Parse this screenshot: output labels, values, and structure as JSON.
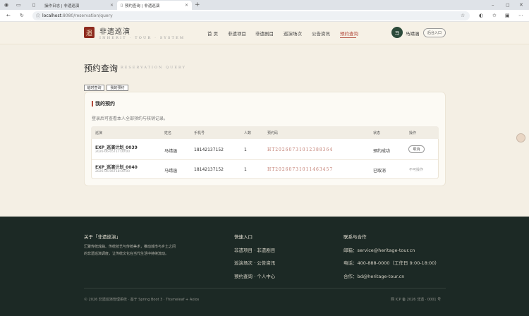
{
  "browser": {
    "tabs": [
      {
        "title": "操作日志 | 非遗巡演"
      },
      {
        "title": "预约查询 | 非遗巡演"
      }
    ],
    "url_host": "localhost",
    "url_path": ":8080/reservation/query"
  },
  "site": {
    "logo_char": "遗",
    "brand_name": "非遗巡演",
    "brand_sub": "INHERIT · TOUR · SYSTEM",
    "nav": [
      "首 页",
      "非遗项目",
      "非遗剧目",
      "巡演场次",
      "公告资讯",
      "预约查询"
    ],
    "user_avatar": "马",
    "user_name": "马靖涵",
    "admin_label": "后台入口"
  },
  "page": {
    "title": "预约查询",
    "title_en": "RESERVATION QUERY",
    "tabs": [
      "临时查询",
      "我的预约"
    ]
  },
  "card": {
    "title": "我的预约",
    "hint": "登录后可查看本人全部预约与核销记录。",
    "columns": [
      "巡演",
      "姓名",
      "手机号",
      "人数",
      "预约码",
      "状态",
      "操作"
    ],
    "rows": [
      {
        "tour": "EXP_巡演计划_0039",
        "time": "2026-06-05T17:00:00",
        "name": "马靖涵",
        "phone": "18142137152",
        "count": "1",
        "code": "HT20260731012388364",
        "status": "预约成功",
        "action": "取消"
      },
      {
        "tour": "EXP_巡演计划_0040",
        "time": "2026-06-06T18:00:00",
        "name": "马靖涵",
        "phone": "18142137152",
        "count": "1",
        "code": "HT20260731011463457",
        "status": "已取消",
        "action": "不可操作"
      }
    ]
  },
  "footer": {
    "about_title": "关于「非遗巡演」",
    "about_text_1": "汇聚传统戏曲、传统技艺与传统美术，推动城市与乡土之间",
    "about_text_2": "的非遗巡演调度，让传统文化在当代生活中持续流动。",
    "links_title": "快速入口",
    "links": [
      "非遗项目 · 非遗剧目",
      "巡演场次 · 公告资讯",
      "预约查询 · 个人中心"
    ],
    "contact_title": "联系与合作",
    "contacts": [
      "邮箱：service@heritage-tour.cn",
      "电话：400-888-0000（工作日 9:00-18:00）",
      "合作：bd@heritage-tour.cn"
    ],
    "copyright": "© 2026 非遗巡演管理系统 · 基于 Spring Boot 3 · Thymeleaf + Axios",
    "icp": "网 ICP 备 2026 非遗 · 0001 号"
  },
  "colors": {
    "accent": "#b24a3c",
    "brand": "#8e2b1f",
    "footer_bg": "#1c2925",
    "page_bg": "#f4efe4"
  }
}
